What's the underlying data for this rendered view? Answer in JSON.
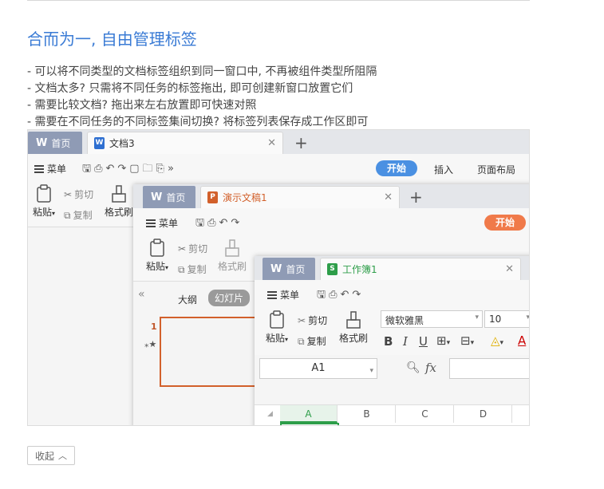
{
  "article": {
    "heading": "合而为一, 自由管理标签",
    "bullets": [
      "- 可以将不同类型的文档标签组织到同一窗口中, 不再被组件类型所阻隔",
      "- 文档太多? 只需将不同任务的标签拖出, 即可创建新窗口放置它们",
      "- 需要比较文档? 拖出来左右放置即可快速对照",
      "- 需要在不同任务的不同标签集间切换? 将标签列表保存成工作区即可"
    ],
    "collapse_label": "收起"
  },
  "win1": {
    "home_tab": "首页",
    "doc_tab": "文档3",
    "menu": "菜单",
    "start": "开始",
    "tabs": [
      "插入",
      "页面布局"
    ],
    "paste": "粘贴",
    "cut": "剪切",
    "copy": "复制",
    "format_painter": "格式刷"
  },
  "win2": {
    "home_tab": "首页",
    "doc_tab": "演示文稿1",
    "menu": "菜单",
    "start": "开始",
    "paste": "粘贴",
    "cut": "剪切",
    "copy": "复制",
    "format_painter": "格式刷",
    "outline_tab": "大纲",
    "slides_tab": "幻灯片",
    "slide_number": "1"
  },
  "win3": {
    "home_tab": "首页",
    "doc_tab": "工作簿1",
    "menu": "菜单",
    "paste": "粘贴",
    "cut": "剪切",
    "copy": "复制",
    "format_painter": "格式刷",
    "font_name": "微软雅黑",
    "font_size": "10",
    "cell_ref": "A1",
    "fx": "fx",
    "columns": [
      "A",
      "B",
      "C",
      "D"
    ]
  },
  "colors": {
    "accent": "#3a7bd5",
    "writer": "#2e6fd1",
    "presentation": "#d2602b",
    "spreadsheet": "#2e9e4a",
    "start_writer": "#4a90e2",
    "start_presentation": "#f07a4a"
  }
}
